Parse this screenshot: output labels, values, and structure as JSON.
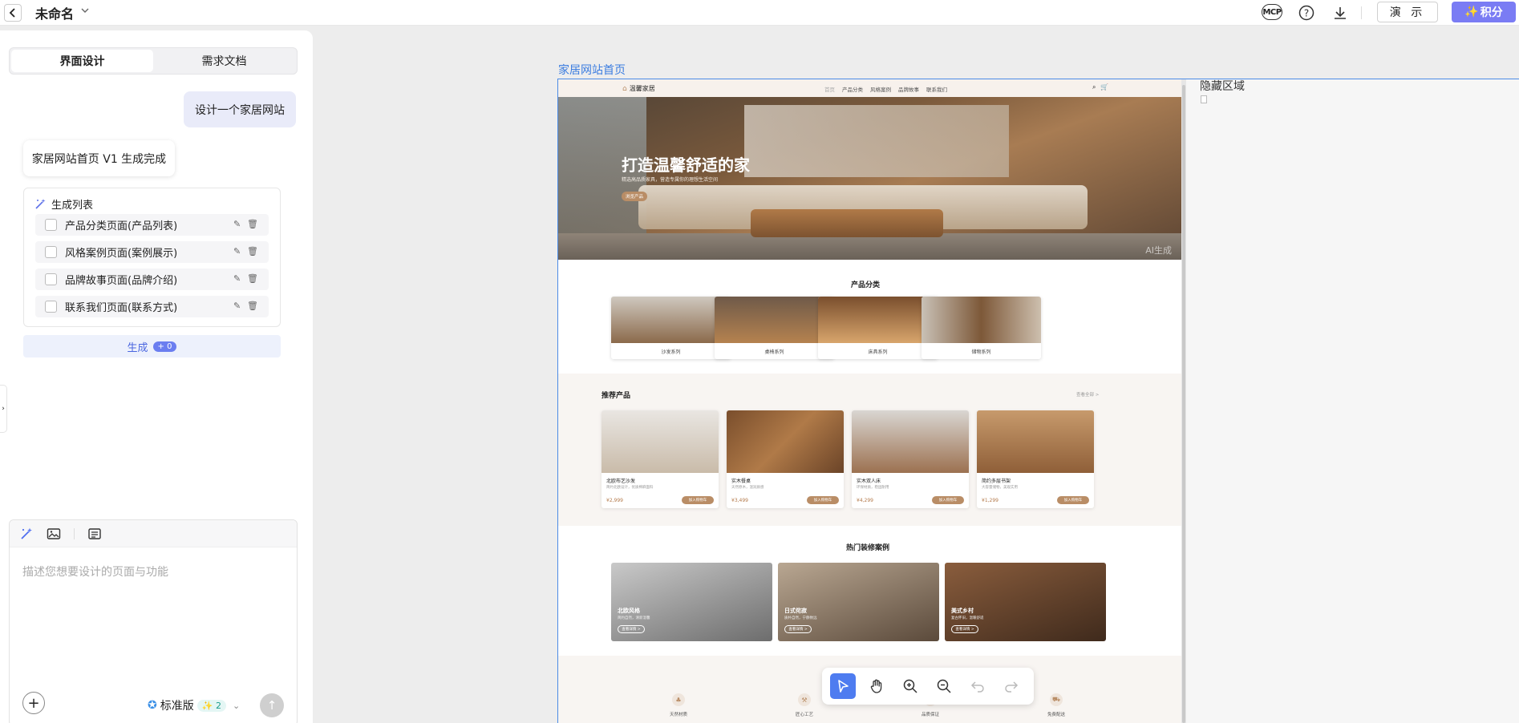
{
  "topbar": {
    "title": "未命名",
    "icons": [
      "back-icon",
      "chevron-down-icon",
      "mcp-icon",
      "help-icon",
      "download-icon"
    ],
    "mcp_label": "MCP",
    "demo_label": "演 示",
    "points_label": "积分",
    "accent_color": "#7a7cf4"
  },
  "sidebar": {
    "tabs": [
      {
        "label": "界面设计",
        "active": true
      },
      {
        "label": "需求文档",
        "active": false
      }
    ],
    "user_message": "设计一个家居网站",
    "bot_message": "家居网站首页 V1 生成完成",
    "gen_list": {
      "title": "生成列表",
      "items": [
        {
          "label": "产品分类页面(产品列表)",
          "checked": false
        },
        {
          "label": "风格案例页面(案例展示)",
          "checked": false
        },
        {
          "label": "品牌故事页面(品牌介绍)",
          "checked": false
        },
        {
          "label": "联系我们页面(联系方式)",
          "checked": false
        }
      ]
    },
    "generate_button": {
      "label": "生成",
      "badge": "0"
    },
    "composer": {
      "placeholder": "描述您想要设计的页面与功能",
      "tier_label": "标准版",
      "tier_badge": "2"
    }
  },
  "canvas": {
    "frame_title": "家居网站首页",
    "hidden_area_title": "隐藏区域",
    "tools": [
      "select-icon",
      "hand-icon",
      "zoom-in-icon",
      "zoom-out-icon",
      "undo-icon",
      "redo-icon"
    ],
    "active_tool": "select-icon",
    "active_color": "#4e7cf0"
  },
  "preview": {
    "brand": "温馨家居",
    "menu": [
      "首页",
      "产品分类",
      "风格案例",
      "品牌故事",
      "联系我们"
    ],
    "hero": {
      "title": "打造温馨舒适的家",
      "subtitle": "精选高品质家具，营造专属你的理想生活空间",
      "button": "浏览产品",
      "watermark": "AI生成"
    },
    "categories_title": "产品分类",
    "categories": [
      {
        "label": "沙发系列"
      },
      {
        "label": "桌椅系列"
      },
      {
        "label": "床具系列"
      },
      {
        "label": "储物系列"
      }
    ],
    "recommended_title": "推荐产品",
    "more_label": "查看全部 >",
    "products": [
      {
        "name": "北欧布艺沙发",
        "desc": "简约北欧设计，优质棉麻面料",
        "price": "¥2,999",
        "cart": "加入购物车"
      },
      {
        "name": "实木餐桌",
        "desc": "天然原木，温润质感",
        "price": "¥3,499",
        "cart": "加入购物车"
      },
      {
        "name": "实木双人床",
        "desc": "环保材质，稳固耐用",
        "price": "¥4,299",
        "cart": "加入购物车"
      },
      {
        "name": "简约多层书架",
        "desc": "大容量储物，美观实用",
        "price": "¥1,299",
        "cart": "加入购物车"
      }
    ],
    "cases_title": "热门装修案例",
    "cases": [
      {
        "name": "北欧风格",
        "desc": "简约自然，清新温馨",
        "button": "查看详情 >"
      },
      {
        "name": "日式侘寂",
        "desc": "质朴自然，宁静致远",
        "button": "查看详情 >"
      },
      {
        "name": "美式乡村",
        "desc": "复古怀旧，温暖舒适",
        "button": "查看详情 >"
      }
    ],
    "features": [
      {
        "label": "天然材质"
      },
      {
        "label": "匠心工艺"
      },
      {
        "label": "品质保证"
      },
      {
        "label": "免费配送"
      }
    ]
  }
}
